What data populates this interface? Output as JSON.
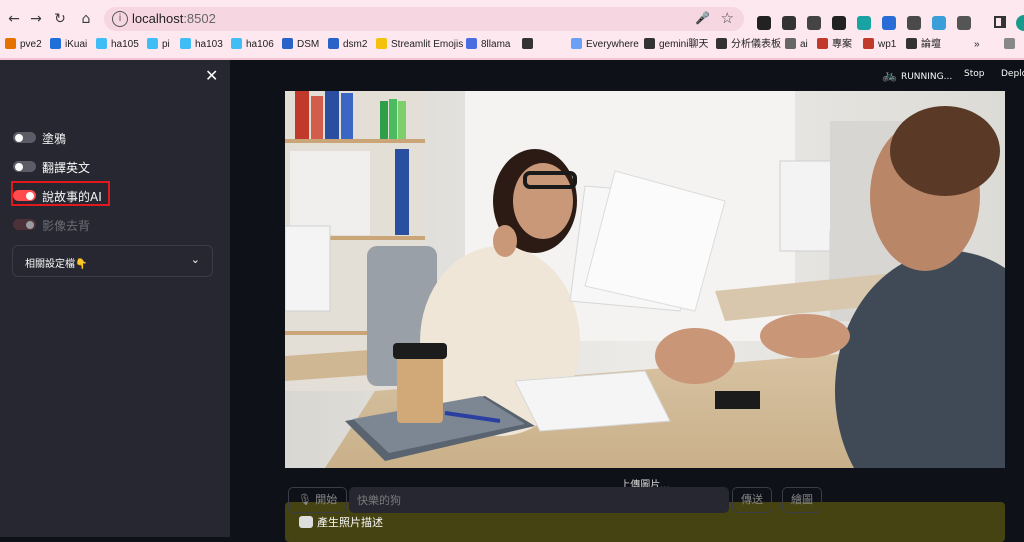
{
  "browser": {
    "url_host": "localhost",
    "url_port": ":8502",
    "bookmarks": [
      {
        "label": "pve2",
        "color": "#e57200"
      },
      {
        "label": "iKuai",
        "color": "#1e6fd9"
      },
      {
        "label": "ha105",
        "color": "#41bdf5"
      },
      {
        "label": "pi",
        "color": "#41bdf5"
      },
      {
        "label": "ha103",
        "color": "#41bdf5"
      },
      {
        "label": "ha106",
        "color": "#41bdf5"
      },
      {
        "label": "DSM",
        "color": "#2a63c7"
      },
      {
        "label": "dsm2",
        "color": "#2a63c7"
      },
      {
        "label": "Streamlit Emojis",
        "color": "#f4c20d"
      },
      {
        "label": "8llama",
        "color": "#4a6ee0"
      },
      {
        "label": "",
        "color": "#333333"
      },
      {
        "label": "Everywhere",
        "color": "#6aa0f7"
      },
      {
        "label": "gemini聊天",
        "color": "#333333"
      },
      {
        "label": "分析儀表板",
        "color": "#333333"
      },
      {
        "label": "ai",
        "color": "#666666"
      },
      {
        "label": "專案",
        "color": "#c0392b"
      },
      {
        "label": "wp1",
        "color": "#c0392b"
      },
      {
        "label": "論壇",
        "color": "#333333"
      }
    ]
  },
  "sidebar": {
    "toggles": [
      {
        "label": "塗鴉",
        "on": false,
        "disabled": false
      },
      {
        "label": "翻譯英文",
        "on": false,
        "disabled": false
      },
      {
        "label": "說故事的AI",
        "on": true,
        "disabled": false
      },
      {
        "label": "影像去背",
        "on": true,
        "disabled": true
      }
    ],
    "expander_label": "相關設定檔👇"
  },
  "header": {
    "running_label": "RUNNING...",
    "stop_label": "Stop",
    "deploy_label": "Deplo"
  },
  "main": {
    "image_caption": "上傳圖片...",
    "start_label": "🎙 開始",
    "input_placeholder": "快樂的狗",
    "send_label": "傳送",
    "draw_label": "繪圖",
    "status_text": "產生照片描述"
  }
}
